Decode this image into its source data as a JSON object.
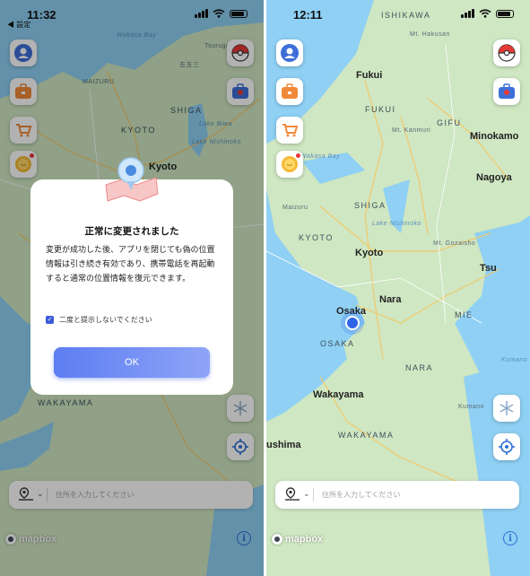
{
  "colors": {
    "accent": "#3b5bdb",
    "map_land": "#cfe7c2",
    "map_water": "#8fd0f4",
    "user_dot": "#2f63e8"
  },
  "left_screen": {
    "status": {
      "time": "11:32",
      "back_label": "◀ 設定"
    },
    "map_labels": {
      "wakasa_bay": "Wakasa Bay",
      "tsuruga": "Tsuruga",
      "gogoro": "五五三",
      "maizuru": "MAIZURU",
      "shiga": "SHIGA",
      "lake_biwa": "Lake Biwa",
      "kyoto_pref": "KYOTO",
      "lake_nishinoko": "Lake Nishinoko",
      "kyoto_city": "Kyoto",
      "wakayama": "WAKAYAMA"
    },
    "dialog": {
      "title": "正常に変更されました",
      "body": "変更が成功した後、アプリを閉じても偽の位置情報は引き続き有効であり、携帯電話を再起動すると通常の位置情報を復元できます。",
      "checkbox_label": "二度と提示しないでください",
      "checkbox_checked": true,
      "ok_label": "OK"
    },
    "search": {
      "placeholder": "住所を入力してください"
    },
    "attribution": "mapbox"
  },
  "right_screen": {
    "status": {
      "time": "12:11"
    },
    "map_labels": {
      "ishikawa": "ISHIKAWA",
      "mt_hakusan": "Mt. Hakusan",
      "fukui": "Fukui",
      "fukui_pref": "FUKUI",
      "gifu": "GIFU",
      "mt_kanmuri": "Mt. Kanmuri",
      "minokamo": "Minokamo",
      "wakasa_bay": "Wakasa Bay",
      "nagoya": "Nagoya",
      "maizuru": "Maizuru",
      "shiga": "SHIGA",
      "lake_nishinoko": "Lake Nishinoko",
      "mt_gozaisho": "Mt. Gozaisho",
      "kyoto_pref": "KYOTO",
      "kyoto": "Kyoto",
      "tsu": "Tsu",
      "nara": "Nara",
      "osaka": "Osaka",
      "mie": "MIE",
      "osaka_pref": "OSAKA",
      "nara_pref": "NARA",
      "wakayama": "Wakayama",
      "kumano": "Kumano",
      "kushima": "ushima",
      "wakayama_pref": "WAKAYAMA",
      "kumano_sea": "Kumano"
    },
    "search": {
      "placeholder": "住所を入力してください"
    },
    "attribution": "mapbox"
  },
  "icons": {
    "profile": "person-icon",
    "briefcase": "briefcase-icon",
    "cart": "cart-icon",
    "coin": "coin-icon",
    "pokeball": "pokeball-icon",
    "toolbox": "toolbox-icon",
    "freeze": "snowflake-icon",
    "locate": "crosshair-icon",
    "pin": "map-pin-icon",
    "info": "info-icon"
  }
}
